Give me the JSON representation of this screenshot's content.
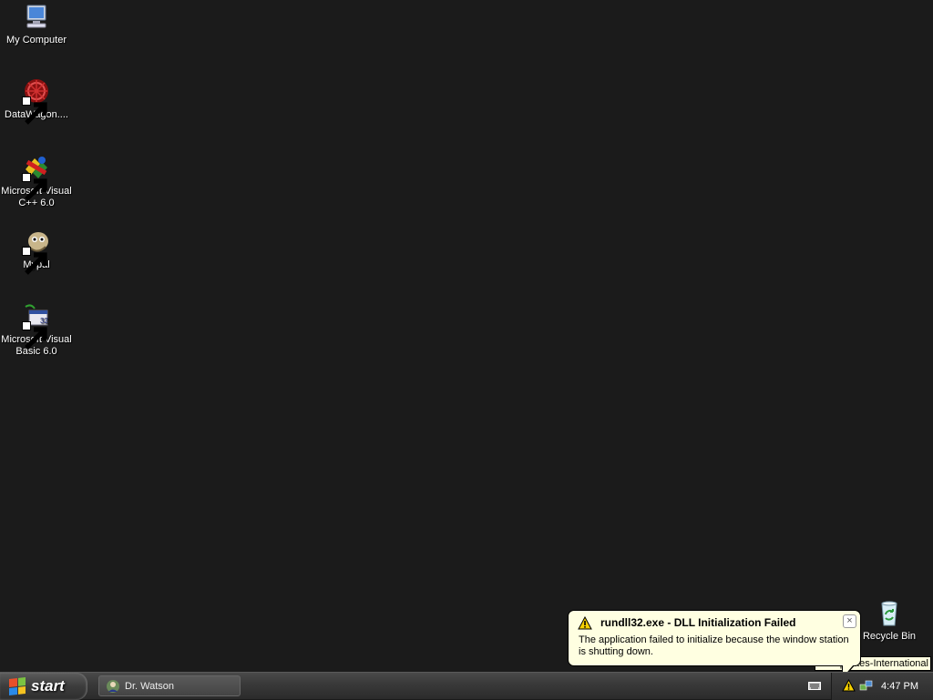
{
  "desktop": {
    "icons": [
      {
        "label": "My Computer",
        "icon": "my-computer-icon"
      },
      {
        "label": "DataWagon....",
        "icon": "datawagon-icon"
      },
      {
        "label": "Microsoft Visual C++ 6.0",
        "icon": "visual-cpp-icon"
      },
      {
        "label": "Mypal",
        "icon": "mypal-icon"
      },
      {
        "label": "Microsoft Visual Basic 6.0",
        "icon": "visual-basic-icon"
      }
    ],
    "recycle_bin": {
      "label": "Recycle Bin",
      "icon": "recycle-bin-icon"
    }
  },
  "taskbar": {
    "start_label": "start",
    "task_buttons": [
      {
        "label": "Dr. Watson",
        "icon": "dr-watson-icon"
      }
    ],
    "clock": "4:47 PM"
  },
  "tooltip": {
    "text": "Updates-International"
  },
  "balloon": {
    "title": "rundll32.exe - DLL Initialization Failed",
    "message": "The application failed to initialize because the window station is shutting down.",
    "close_label": "×"
  },
  "colors": {
    "desktop": "#1b1b1b",
    "balloon": "#ffffe1"
  }
}
